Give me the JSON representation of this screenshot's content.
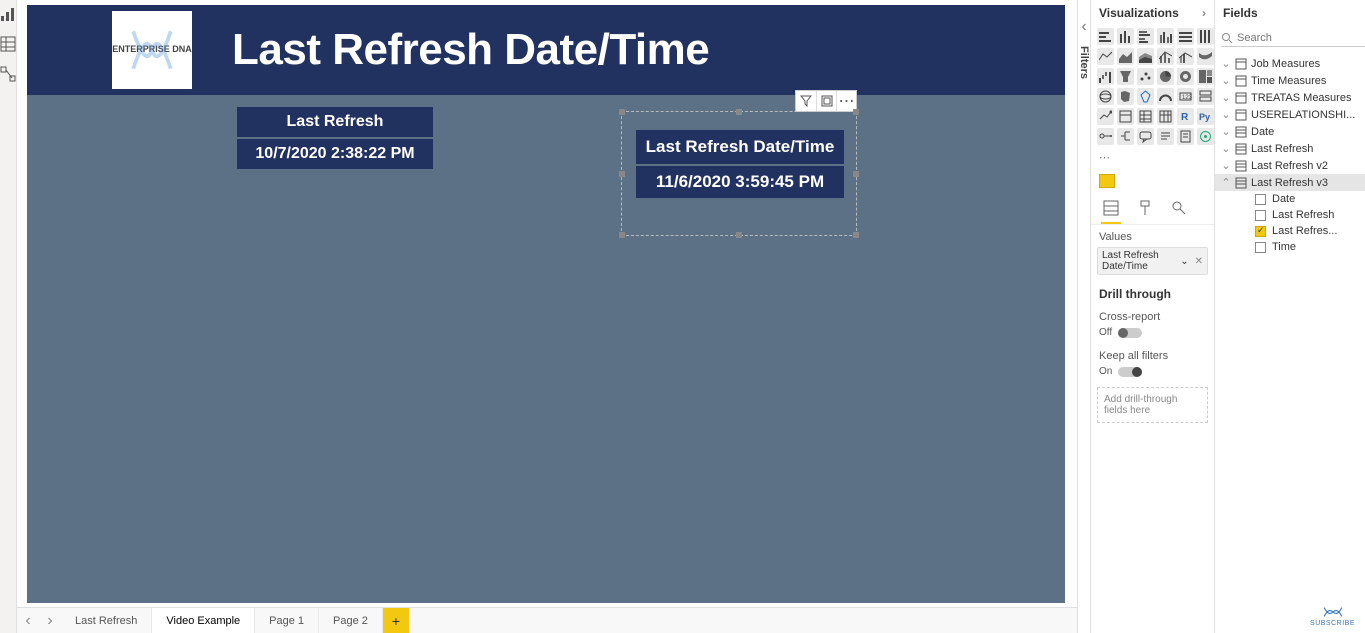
{
  "leftRail": {
    "icons": [
      "report-view",
      "data-view",
      "model-view"
    ]
  },
  "report": {
    "title": "Last Refresh Date/Time",
    "logoText": "ENTERPRISE DNA",
    "card1": {
      "label": "Last Refresh",
      "value": "10/7/2020 2:38:22 PM"
    },
    "card2": {
      "label": "Last Refresh Date/Time",
      "value": "11/6/2020 3:59:45 PM"
    }
  },
  "filters": {
    "label": "Filters"
  },
  "pageTabs": {
    "tabs": [
      "Last Refresh",
      "Video Example",
      "Page 1",
      "Page 2"
    ],
    "active": 1
  },
  "vizPane": {
    "title": "Visualizations",
    "valuesLabel": "Values",
    "valuePill": "Last Refresh Date/Time",
    "drillThrough": "Drill through",
    "crossReportLabel": "Cross-report",
    "crossReportState": "Off",
    "keepFiltersLabel": "Keep all filters",
    "keepFiltersState": "On",
    "dropHint": "Add drill-through fields here"
  },
  "fieldsPane": {
    "title": "Fields",
    "searchPlaceholder": "Search",
    "tables": [
      {
        "name": "Job Measures",
        "type": "measure",
        "expanded": false
      },
      {
        "name": "Time Measures",
        "type": "measure",
        "expanded": false
      },
      {
        "name": "TREATAS Measures",
        "type": "measure",
        "expanded": false
      },
      {
        "name": "USERELATIONSHI...",
        "type": "measure",
        "expanded": false
      },
      {
        "name": "Date",
        "type": "table",
        "expanded": false
      },
      {
        "name": "Last Refresh",
        "type": "table",
        "expanded": false
      },
      {
        "name": "Last Refresh v2",
        "type": "table",
        "expanded": false
      },
      {
        "name": "Last Refresh v3",
        "type": "table",
        "expanded": true,
        "selected": true,
        "fields": [
          {
            "name": "Date",
            "checked": false
          },
          {
            "name": "Last Refresh",
            "checked": false
          },
          {
            "name": "Last Refres...",
            "checked": true
          },
          {
            "name": "Time",
            "checked": false
          }
        ]
      }
    ]
  },
  "subscribe": "SUBSCRIBE"
}
